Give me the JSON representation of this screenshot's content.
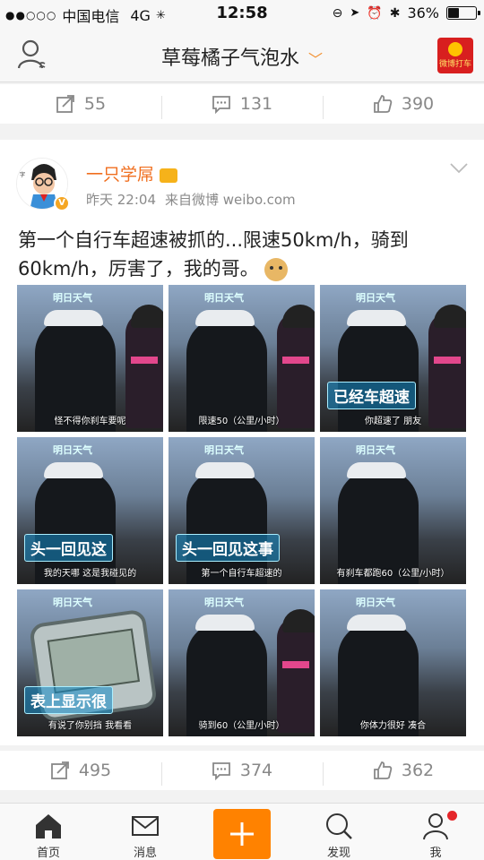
{
  "status_bar": {
    "signal": "●●○○○",
    "carrier": "中国电信",
    "network": "4G",
    "time": "12:58",
    "battery": "36%",
    "battery_level": 0.36
  },
  "nav": {
    "title": "草莓橘子气泡水",
    "dropdown_glyph": "﹀",
    "badge_label": "微博打车"
  },
  "prev_post_actions": {
    "repost": "55",
    "comment": "131",
    "like": "390"
  },
  "post": {
    "username": "一只学屌",
    "time": "昨天 22:04",
    "source": "来自微博 weibo.com",
    "text": "第一个自行车超速被抓的...限速50km/h，骑到60km/h，厉害了，我的哥。",
    "images": [
      {
        "subtitle": "怪不得你刹车要呢",
        "banner": ""
      },
      {
        "subtitle": "限速50（公里/小时）",
        "banner": ""
      },
      {
        "subtitle": "你超速了 朋友",
        "banner": "已经车超速"
      },
      {
        "subtitle": "我的天哪 这是我碰见的",
        "banner": "头一回见这"
      },
      {
        "subtitle": "第一个自行车超速的",
        "banner": "头一回见这事"
      },
      {
        "subtitle": "有刹车都跑60（公里/小时）",
        "banner": ""
      },
      {
        "subtitle": "有说了你别挡 我看看",
        "banner": "表上显示很"
      },
      {
        "subtitle": "骑到60（公里/小时）",
        "banner": ""
      },
      {
        "subtitle": "你体力很好 凑合",
        "banner": ""
      }
    ],
    "tv_logo": "明日天气",
    "actions": {
      "repost": "495",
      "comment": "374",
      "like": "362"
    }
  },
  "tabs": [
    {
      "label": "首页",
      "icon": "home-icon"
    },
    {
      "label": "消息",
      "icon": "mail-icon"
    },
    {
      "label": "",
      "icon": "plus-icon"
    },
    {
      "label": "发现",
      "icon": "search-icon"
    },
    {
      "label": "我",
      "icon": "person-icon"
    }
  ],
  "colors": {
    "accent": "#ff8200",
    "username": "#f06e1e",
    "notification": "#e5262a"
  }
}
